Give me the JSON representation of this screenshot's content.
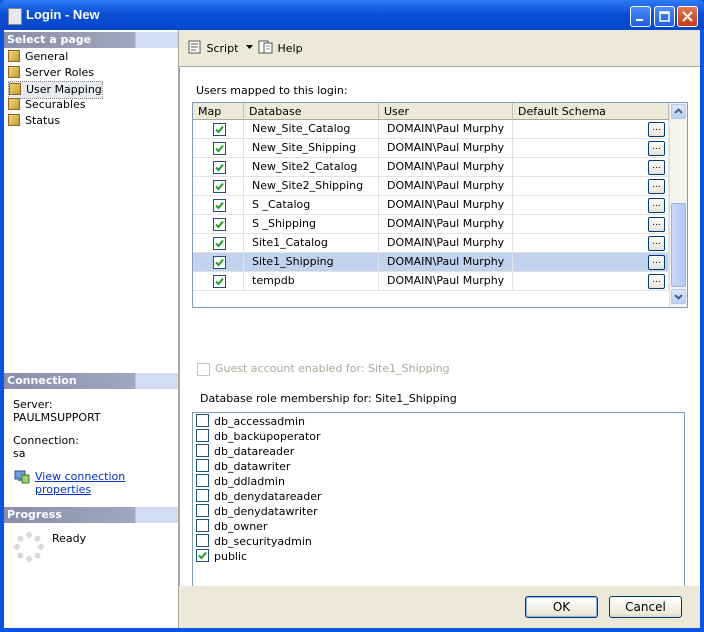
{
  "window": {
    "title": "Login - New"
  },
  "left": {
    "select_page_header": "Select a page",
    "pages": [
      {
        "label": "General"
      },
      {
        "label": "Server Roles"
      },
      {
        "label": "User Mapping"
      },
      {
        "label": "Securables"
      },
      {
        "label": "Status"
      }
    ],
    "connection_header": "Connection",
    "server_label": "Server:",
    "server_value": "PAULMSUPPORT",
    "connection_label": "Connection:",
    "connection_value": "sa",
    "view_props_link": "View connection properties",
    "progress_header": "Progress",
    "progress_status": "Ready"
  },
  "toolbar": {
    "script_label": "Script",
    "help_label": "Help"
  },
  "mapping": {
    "title": "Users mapped to this login:",
    "columns": [
      "Map",
      "Database",
      "User",
      "Default Schema"
    ],
    "rows": [
      {
        "checked": true,
        "database": "New_Site_Catalog",
        "user": "DOMAIN\\Paul Murphy",
        "schema": ""
      },
      {
        "checked": true,
        "database": "New_Site_Shipping",
        "user": "DOMAIN\\Paul Murphy",
        "schema": ""
      },
      {
        "checked": true,
        "database": "New_Site2_Catalog",
        "user": "DOMAIN\\Paul Murphy",
        "schema": ""
      },
      {
        "checked": true,
        "database": "New_Site2_Shipping",
        "user": "DOMAIN\\Paul Murphy",
        "schema": ""
      },
      {
        "checked": true,
        "database": "S _Catalog",
        "user": "DOMAIN\\Paul Murphy",
        "schema": ""
      },
      {
        "checked": true,
        "database": "S _Shipping",
        "user": "DOMAIN\\Paul Murphy",
        "schema": ""
      },
      {
        "checked": true,
        "database": "Site1_Catalog",
        "user": "DOMAIN\\Paul Murphy",
        "schema": ""
      },
      {
        "checked": true,
        "database": "Site1_Shipping",
        "user": "DOMAIN\\Paul Murphy",
        "schema": "",
        "selected": true
      },
      {
        "checked": true,
        "database": "tempdb",
        "user": "DOMAIN\\Paul Murphy",
        "schema": ""
      }
    ],
    "button_glyph": "..."
  },
  "guest": {
    "label": "Guest account enabled for: Site1_Shipping",
    "checked": false
  },
  "roles": {
    "title": "Database role membership for: Site1_Shipping",
    "items": [
      {
        "label": "db_accessadmin",
        "checked": false
      },
      {
        "label": "db_backupoperator",
        "checked": false
      },
      {
        "label": "db_datareader",
        "checked": false
      },
      {
        "label": "db_datawriter",
        "checked": false
      },
      {
        "label": "db_ddladmin",
        "checked": false
      },
      {
        "label": "db_denydatareader",
        "checked": false
      },
      {
        "label": "db_denydatawriter",
        "checked": false
      },
      {
        "label": "db_owner",
        "checked": false
      },
      {
        "label": "db_securityadmin",
        "checked": false
      },
      {
        "label": "public",
        "checked": true
      }
    ]
  },
  "buttons": {
    "ok": "OK",
    "cancel": "Cancel"
  },
  "colors": {
    "title_bar": "#0a54e6",
    "selected_row": "#c1d2ee",
    "link": "#0033cc"
  }
}
